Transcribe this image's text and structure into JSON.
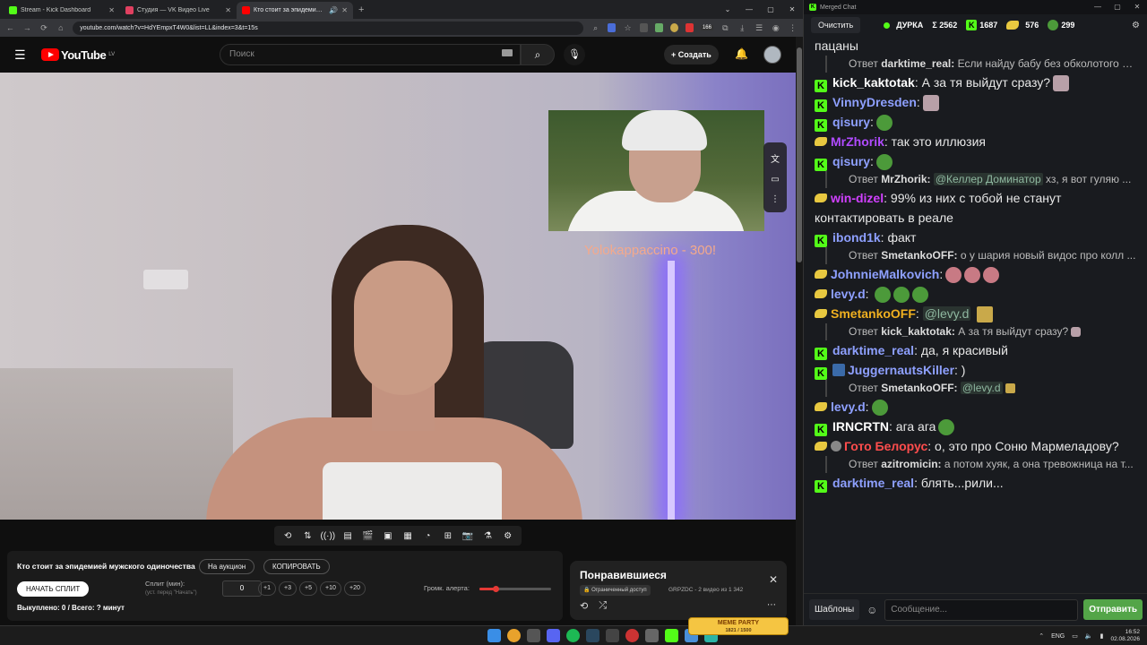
{
  "browser": {
    "tabs": [
      {
        "title": "Stream - Kick Dashboard",
        "color": "#53fc18",
        "active": false
      },
      {
        "title": "Студия — VK Видео Live",
        "color": "#e04060",
        "active": false
      },
      {
        "title": "Кто стоит за эпидемией м...",
        "color": "#ff0000",
        "active": true
      }
    ],
    "url": "youtube.com/watch?v=HdYEmpxT4W0&list=LL&index=3&t=15s",
    "ext_badge": "166"
  },
  "youtube": {
    "logo_text": "YouTube",
    "region": "LV",
    "search_placeholder": "Поиск",
    "create_label": "Создать"
  },
  "video": {
    "alert_text": "Yolokappaccino - 300!"
  },
  "auction": {
    "title": "Кто стоит за эпидемией мужского одиночества",
    "to_auction": "На аукцион",
    "copy": "КОПИРОВАТЬ",
    "start_split": "НАЧАТЬ СПЛИТ",
    "split_label": "Сплит (мин):",
    "split_hint": "(уст. перед \"Начать\")",
    "split_value": "0",
    "increments": [
      "+1",
      "+3",
      "+5",
      "+10",
      "+20"
    ],
    "volume_label": "Громк. алерта:",
    "volume_level": 0.22,
    "bought": "Выкуплено: 0 / Всего: ? минут"
  },
  "playlist": {
    "title": "Понравившиеся",
    "access": "Ограниченный доступ",
    "meta": "GRPZDC - 2 видео из 1 342"
  },
  "chat": {
    "window_title": "Merged Chat",
    "clear_label": "Очистить",
    "channel": "ДУРКА",
    "total": "Σ 2562",
    "kick_count": "1687",
    "tw_count": "576",
    "vk_count": "299",
    "input_placeholder": "Сообщение...",
    "templates_label": "Шаблоны",
    "send_label": "Отправить",
    "messages": [
      {
        "kind": "cont",
        "text": "пацаны"
      },
      {
        "kind": "reply",
        "prefix": "Ответ",
        "user": "darktime_real:",
        "text": " Если найду бабу без обколотого л..."
      },
      {
        "kind": "msg",
        "badge": "k",
        "user": "kick_kaktotak",
        "color": "#ffffff",
        "text": " А за тя выйдут сразу?",
        "emotes": [
          "cat"
        ]
      },
      {
        "kind": "msg",
        "badge": "k",
        "user": "VinnyDresden",
        "color": "#8ea0ff",
        "text": "",
        "emotes": [
          "cat"
        ]
      },
      {
        "kind": "msg",
        "badge": "k",
        "user": "qisury",
        "color": "#8ea0ff",
        "text": "",
        "emotes": [
          "green"
        ]
      },
      {
        "kind": "msg",
        "badge": "tw",
        "user": "MrZhorik",
        "color": "#b04bff",
        "text": " так это иллюзия",
        "emotes": []
      },
      {
        "kind": "msg",
        "badge": "k",
        "user": "qisury",
        "color": "#8ea0ff",
        "text": "",
        "emotes": [
          "green"
        ]
      },
      {
        "kind": "reply",
        "prefix": "Ответ",
        "user": "MrZhorik:",
        "mention": "@Келлер Доминатор",
        "text": " хз, я вот гуляю ..."
      },
      {
        "kind": "msg",
        "badge": "tw",
        "user": "win-dizel",
        "color": "#d040ff",
        "text": " 99% из них с тобой не станут контактировать в реале",
        "emotes": []
      },
      {
        "kind": "msg",
        "badge": "k",
        "user": "ibond1k",
        "color": "#8ea0ff",
        "text": " факт",
        "emotes": []
      },
      {
        "kind": "reply",
        "prefix": "Ответ",
        "user": "SmetankoOFF:",
        "text": " о у шария новый видос про колл ..."
      },
      {
        "kind": "msg",
        "badge": "tw",
        "user": "JohnnieMalkovich",
        "color": "#8ea0ff",
        "text": "",
        "emotes": [
          "pink",
          "pink",
          "pink"
        ]
      },
      {
        "kind": "msg",
        "badge": "tw",
        "user": "levy.d",
        "color": "#8ea0ff",
        "text": " ",
        "emotes": [
          "green",
          "green",
          "green"
        ]
      },
      {
        "kind": "msg",
        "badge": "tw",
        "user": "SmetankoOFF",
        "color": "#f0b020",
        "text": " ",
        "mention": "@levy.d",
        "emotes": [
          "gold"
        ]
      },
      {
        "kind": "reply",
        "prefix": "Ответ",
        "user": "kick_kaktotak:",
        "text": " А за тя выйдут сразу?",
        "emotes": [
          "cat"
        ]
      },
      {
        "kind": "msg",
        "badge": "k",
        "user": "darktime_real",
        "color": "#8ea0ff",
        "text": " да, я красивый",
        "emotes": []
      },
      {
        "kind": "msg",
        "badge": "k",
        "badge2": "sw",
        "user": "JuggernautsKiller",
        "color": "#8ea0ff",
        "text": " )",
        "emotes": []
      },
      {
        "kind": "reply",
        "prefix": "Ответ",
        "user": "SmetankoOFF:",
        "mention": "@levy.d",
        "text": "",
        "emotes": [
          "gold"
        ]
      },
      {
        "kind": "msg",
        "badge": "tw",
        "user": "levy.d",
        "color": "#8ea0ff",
        "text": "",
        "emotes": [
          "green"
        ]
      },
      {
        "kind": "msg",
        "badge": "k",
        "user": "IRNCRTN",
        "color": "#ffffff",
        "text": " ага ага",
        "emotes": [
          "green"
        ]
      },
      {
        "kind": "msg",
        "badge": "tw",
        "badge2": "ok",
        "user": "Гото Белорус",
        "color": "#ff4d4d",
        "text": " о, это про Соню Мармеладову?",
        "emotes": []
      },
      {
        "kind": "reply",
        "prefix": "Ответ",
        "user": "azitromicin:",
        "text": " а потом хуяк, а она тревожница на т..."
      },
      {
        "kind": "msg",
        "badge": "k",
        "user": "darktime_real",
        "color": "#8ea0ff",
        "text": " блять...рили...",
        "emotes": []
      }
    ]
  },
  "taskbar": {
    "meme_title": "MEME PARTY",
    "meme_sub": "1821 / 1500",
    "lang": "ENG",
    "time": "16:52",
    "date": "02.08.2026"
  }
}
